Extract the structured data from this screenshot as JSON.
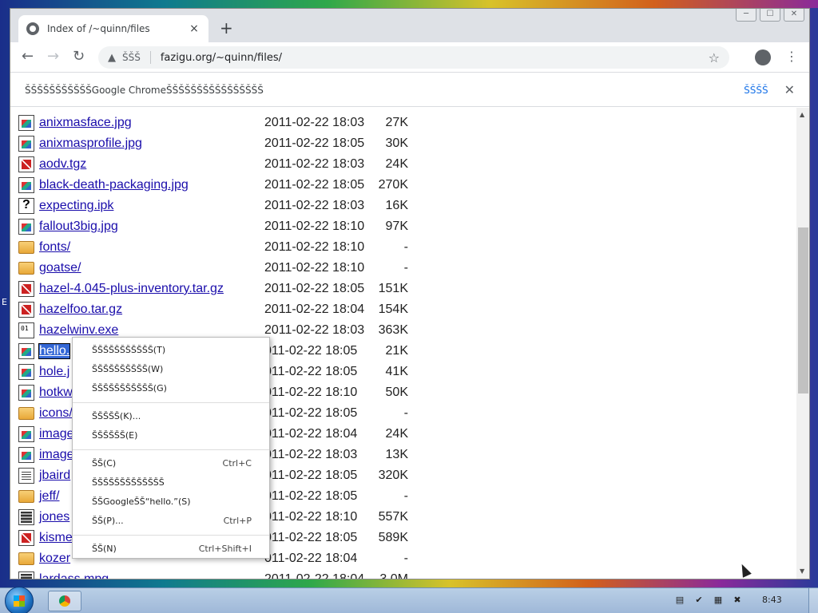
{
  "browser": {
    "tab_title": "Index of /~quinn/files",
    "tab_close": "×",
    "new_tab": "+",
    "window_controls": [
      "─",
      "☐",
      "✕"
    ],
    "back": "←",
    "forward": "→",
    "reload": "↻",
    "secure_icon": "▲",
    "secure_label": "ŠŠŠ",
    "url": "fazigu.org/~quinn/files/",
    "star": "☆",
    "menu": "⋮"
  },
  "infobar": {
    "message": "ŠŠŠŠŠŠŠŠŠŠŠGoogle ChromeŠŠŠŠŠŠŠŠŠŠŠŠŠŠŠŠ",
    "action": "ŠŠŠŠ",
    "close": "✕"
  },
  "left_edge_char": "E",
  "files": [
    {
      "name": "anixmasface.jpg",
      "date": "2011-02-22 18:03",
      "size": "27K",
      "icon": "img"
    },
    {
      "name": "anixmasprofile.jpg",
      "date": "2011-02-22 18:05",
      "size": "30K",
      "icon": "img"
    },
    {
      "name": "aodv.tgz",
      "date": "2011-02-22 18:03",
      "size": "24K",
      "icon": "archive"
    },
    {
      "name": "black-death-packaging.jpg",
      "date": "2011-02-22 18:05",
      "size": "270K",
      "icon": "img"
    },
    {
      "name": "expecting.ipk",
      "date": "2011-02-22 18:03",
      "size": "16K",
      "icon": "unknown"
    },
    {
      "name": "fallout3big.jpg",
      "date": "2011-02-22 18:10",
      "size": "97K",
      "icon": "img"
    },
    {
      "name": "fonts/",
      "date": "2011-02-22 18:10",
      "size": "-",
      "icon": "folder"
    },
    {
      "name": "goatse/",
      "date": "2011-02-22 18:10",
      "size": "-",
      "icon": "folder"
    },
    {
      "name": "hazel-4.045-plus-inventory.tar.gz",
      "date": "2011-02-22 18:05",
      "size": "151K",
      "icon": "archive"
    },
    {
      "name": "hazelfoo.tar.gz",
      "date": "2011-02-22 18:04",
      "size": "154K",
      "icon": "archive"
    },
    {
      "name": "hazelwinv.exe",
      "date": "2011-02-22 18:03",
      "size": "363K",
      "icon": "binary"
    },
    {
      "name": "hello.",
      "date": "011-02-22 18:05",
      "size": "21K",
      "icon": "img",
      "selected": true
    },
    {
      "name": "hole.j",
      "date": "011-02-22 18:05",
      "size": "41K",
      "icon": "img"
    },
    {
      "name": "hotkw",
      "date": "011-02-22 18:10",
      "size": "50K",
      "icon": "img"
    },
    {
      "name": "icons/",
      "date": "011-02-22 18:05",
      "size": "-",
      "icon": "folder"
    },
    {
      "name": "image",
      "date": "011-02-22 18:04",
      "size": "24K",
      "icon": "img"
    },
    {
      "name": "image",
      "date": "011-02-22 18:03",
      "size": "13K",
      "icon": "img"
    },
    {
      "name": "jbaird",
      "date": "011-02-22 18:05",
      "size": "320K",
      "icon": "text"
    },
    {
      "name": "jeff/",
      "date": "011-02-22 18:05",
      "size": "-",
      "icon": "folder"
    },
    {
      "name": "jones",
      "date": "011-02-22 18:10",
      "size": "557K",
      "icon": "movie"
    },
    {
      "name": "kisme",
      "date": "011-02-22 18:05",
      "size": "589K",
      "icon": "archive"
    },
    {
      "name": "kozer",
      "date": "011-02-22 18:04",
      "size": "-",
      "icon": "folder"
    },
    {
      "name": "lardass.mpg",
      "date": "2011-02-22 18:04",
      "size": "3.0M",
      "icon": "movie"
    }
  ],
  "context_menu": {
    "open_new_tab": "ŠŠŠŠŠŠŠŠŠŠŠ(T)",
    "open_new_window": "ŠŠŠŠŠŠŠŠŠŠ(W)",
    "open_incognito": "ŠŠŠŠŠŠŠŠŠŠŠ(G)",
    "save_link": "ŠŠŠŠŠ(K)...",
    "copy_link": "ŠŠŠŠŠŠ(E)",
    "copy": "ŠŠ(C)",
    "copy_shortcut": "Ctrl+C",
    "copy_link_to_highlight": "ŠŠŠŠŠŠŠŠŠŠŠŠŠ",
    "search_google": "ŠŠGoogleŠŠ“hello.”(S)",
    "print": "ŠŠ(P)...",
    "print_shortcut": "Ctrl+P",
    "inspect": "ŠŠ(N)",
    "inspect_shortcut": "Ctrl+Shift+I"
  },
  "taskbar": {
    "clock": "8:43"
  }
}
